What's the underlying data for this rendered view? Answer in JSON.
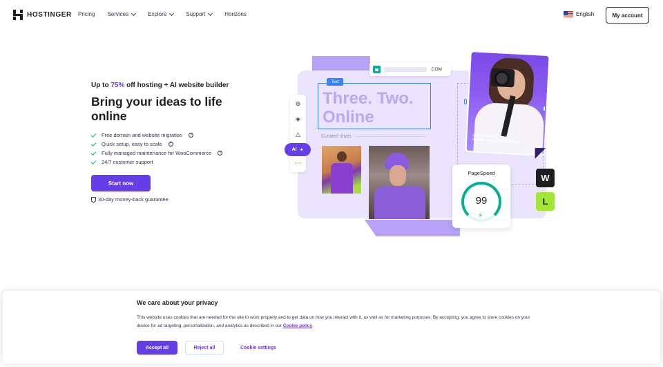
{
  "nav": {
    "logo_text": "HOSTINGER",
    "links": [
      {
        "label": "Pricing",
        "dropdown": false
      },
      {
        "label": "Services",
        "dropdown": true
      },
      {
        "label": "Explore",
        "dropdown": true
      },
      {
        "label": "Support",
        "dropdown": true
      },
      {
        "label": "Horizons",
        "dropdown": false
      }
    ],
    "language": "English",
    "account_label": "My account"
  },
  "hero": {
    "eyebrow_prefix": "Up to ",
    "eyebrow_accent": "75%",
    "eyebrow_suffix": " off hosting + AI website builder",
    "headline": "Bring your ideas to life online",
    "features": [
      {
        "text": "Free domain and website migration",
        "help": true
      },
      {
        "text": "Quick setup, easy to scale",
        "help": true
      },
      {
        "text": "Fully managed maintenance for WooCommerce",
        "help": true
      },
      {
        "text": "24/7 customer support",
        "help": false
      }
    ],
    "cta_label": "Start now",
    "guarantee": "30-day money-back guarantee"
  },
  "illustration": {
    "url_tld": ".COM",
    "text_tag": "Text",
    "big_text": "Three. Two. Online",
    "ai_label": "AI",
    "curated_label": "Curated shots",
    "photo_caption_line1": "Client: Anna Tranquell",
    "photo_caption_line2": "Founder of annatranquell.com",
    "pagespeed_label": "PageSpeed",
    "pagespeed_score": "99",
    "wp_badge": "W",
    "ls_badge": "L"
  },
  "cookie": {
    "title": "We care about your privacy",
    "body": "This website uses cookies that are needed for the site to work properly and to get data on how you interact with it, as well as for marketing purposes. By accepting, you agree to store cookies on your device for ad targeting, personalization, and analytics as described in our ",
    "link": "Cookie policy",
    "body_end": ".",
    "accept": "Accept all",
    "reject": "Reject all",
    "settings": "Cookie settings"
  },
  "colors": {
    "brand": "#673de6",
    "text": "#1d1e20",
    "success": "#00b090"
  }
}
